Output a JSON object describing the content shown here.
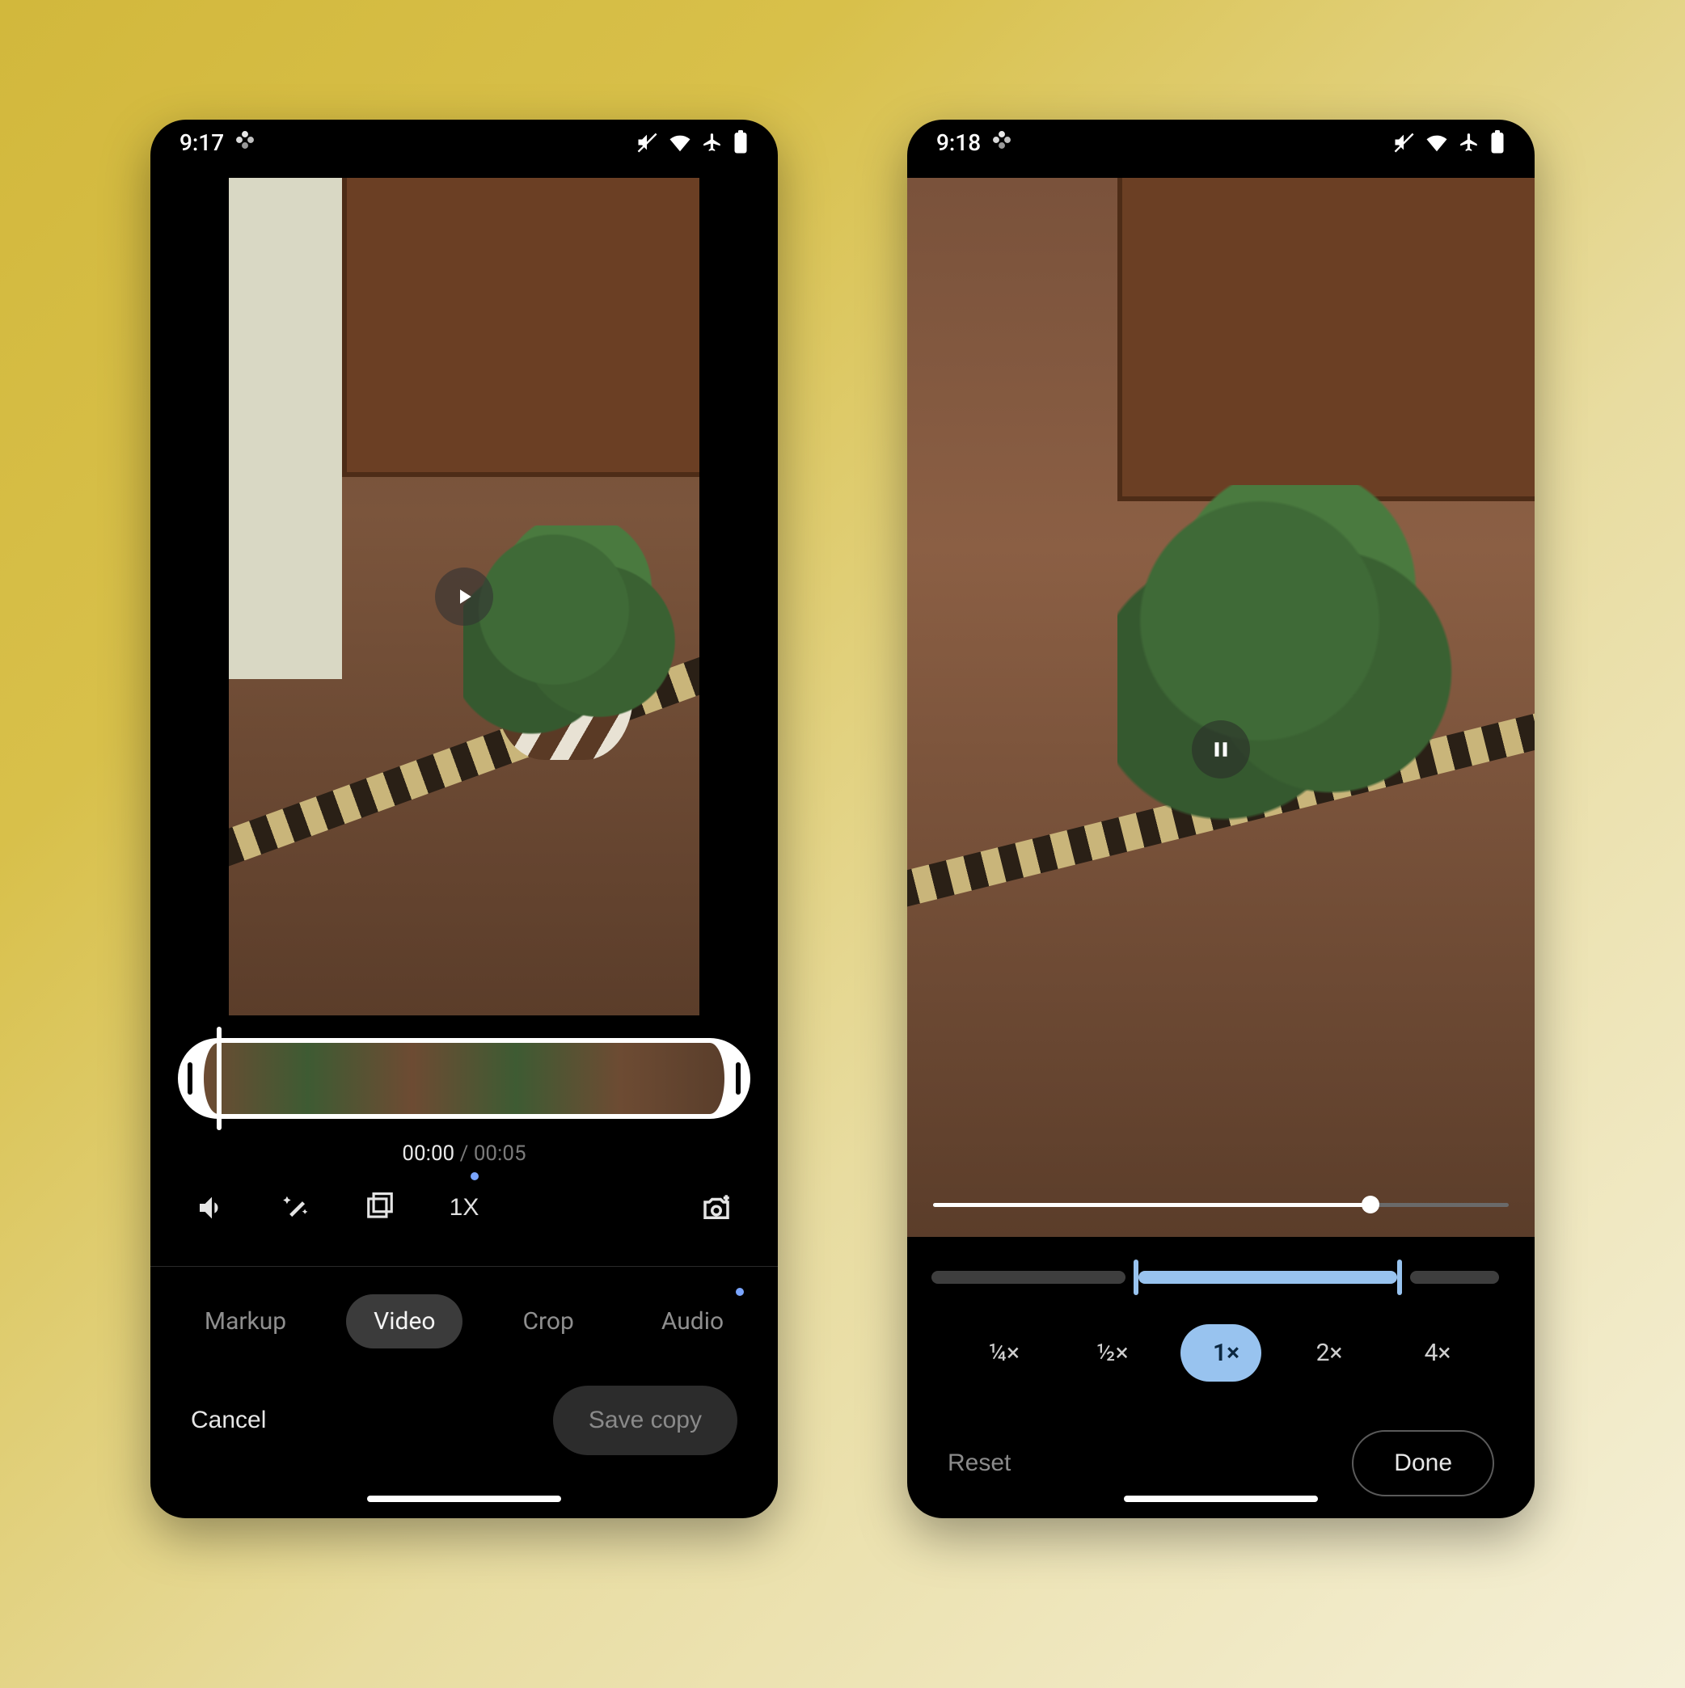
{
  "left": {
    "status": {
      "time": "9:17"
    },
    "play_icon": "play",
    "timestamp": {
      "current": "00:00",
      "duration": "00:05",
      "separator": " / "
    },
    "tools": {
      "volume_icon": "volume",
      "enhance_icon": "magic-wand",
      "frame_icon": "frame-export",
      "speed_label": "1X",
      "camera_icon": "camera-plus"
    },
    "tabs": [
      "Markup",
      "Video",
      "Crop",
      "Audio"
    ],
    "active_tab_index": 1,
    "cancel_label": "Cancel",
    "save_label": "Save copy"
  },
  "right": {
    "status": {
      "time": "9:18"
    },
    "pause_icon": "pause",
    "progress_pct": 76,
    "speed_options": [
      "¼×",
      "½×",
      "1×",
      "2×",
      "4×"
    ],
    "selected_speed_index": 2,
    "reset_label": "Reset",
    "done_label": "Done"
  },
  "status_icons": [
    "mute",
    "wifi",
    "airplane",
    "battery"
  ]
}
